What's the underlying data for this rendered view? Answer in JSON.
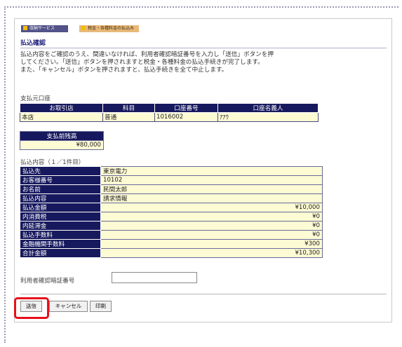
{
  "breadcrumb": {
    "item1": "収納サービス",
    "item2": "税金・各種料金の払込み"
  },
  "page_title": "払込確認",
  "instructions": [
    "払込内容をご確認のうえ、間違いなければ、利用者確認暗証番号を入力し「送信」ボタンを押",
    "してください。「送信」ボタンを押されますと税金・各種料金の払込手続きが完了します。",
    "また、「キャンセル」ボタンを押されますと、払込手続きを全て中止します。"
  ],
  "source_account": {
    "label": "支払元口座",
    "headers": [
      "お取引店",
      "科目",
      "口座番号",
      "口座名義人"
    ],
    "row": [
      "本店",
      "普通",
      "1016002",
      "ｱｱｳ"
    ]
  },
  "balance": {
    "header": "支払前残高",
    "value": "¥80,000"
  },
  "details": {
    "label": "払込内容（１／1件目）",
    "rows": [
      {
        "label": "払込先",
        "value": "東京電力"
      },
      {
        "label": "お客様番号",
        "value": "10102"
      },
      {
        "label": "お名前",
        "value": "民間太郎"
      },
      {
        "label": "払込内容",
        "value": "請求情報"
      },
      {
        "label": "払込金額",
        "value": "¥10,000"
      },
      {
        "label": "内消費税",
        "value": "¥0"
      },
      {
        "label": "内延滞金",
        "value": "¥0"
      },
      {
        "label": "払込手数料",
        "value": "¥0"
      },
      {
        "label": "金融機関手数料",
        "value": "¥300"
      },
      {
        "label": "合計金額",
        "value": "¥10,300"
      }
    ]
  },
  "auth": {
    "label": "利用者確認暗証番号",
    "value": ""
  },
  "buttons": {
    "send": "送信",
    "cancel": "キャンセル",
    "print": "印刷"
  },
  "colors": {
    "header_navy": "#17195e",
    "cell_cream": "#fdfbd4",
    "title_blue": "#1b1b7a",
    "highlight_red": "#e8101a"
  }
}
